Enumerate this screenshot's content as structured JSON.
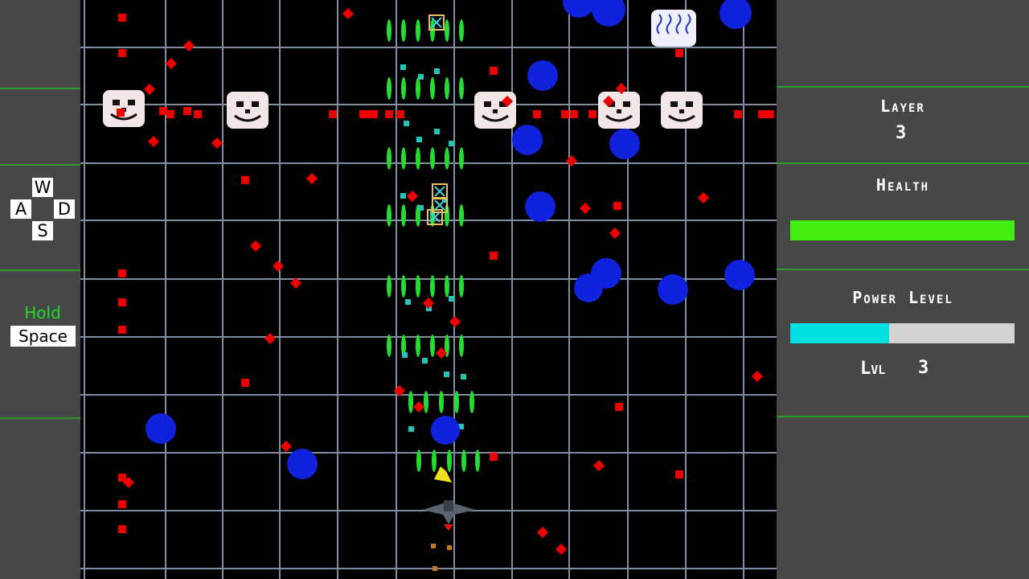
{
  "controls": {
    "keys": {
      "up": "W",
      "left": "A",
      "right": "D",
      "down": "S"
    },
    "hold_label": "Hold",
    "hold_color": "#22dd22",
    "space_label": "Space"
  },
  "hud": {
    "layer_label": "Layer",
    "layer_value": "3",
    "health_label": "Health",
    "health_fraction": 1.0,
    "health_color": "#44ee11",
    "power_label": "Power Level",
    "power_fraction": 0.44,
    "power_color": "#00e0e0",
    "level_label": "Lvl",
    "level_value": "3"
  },
  "playfield": {
    "background": "#000000",
    "grid_color": "#7f8ea0",
    "enemy_bullet_color": "#ee0000",
    "blob_color": "#1122dd",
    "player_shot_color": "#22dd33",
    "skull_color": "#f2e6e6",
    "enemy_names": [
      "skull-enemy",
      "skull-enemy",
      "skull-enemy",
      "skull-enemy",
      "skull-enemy",
      "shield-enemy"
    ]
  }
}
